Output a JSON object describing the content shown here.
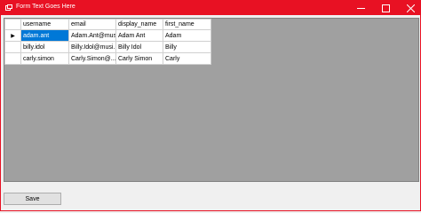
{
  "window": {
    "title": "Form Text Goes Here",
    "accent_color": "#e81123",
    "icons": [
      "app-icon",
      "minimize-icon",
      "maximize-icon",
      "close-icon"
    ]
  },
  "grid": {
    "columns": [
      "username",
      "email",
      "display_name",
      "first_name"
    ],
    "rows": [
      [
        "adam.ant",
        "Adam.Ant@musi...",
        "Adam Ant",
        "Adam"
      ],
      [
        "billy.idol",
        "Billy.Idol@musi...",
        "Billy Idol",
        "Billy"
      ],
      [
        "carly.simon",
        "Carly.Simon@...",
        "Carly Simon",
        "Carly"
      ]
    ],
    "current_row_marker": "▶"
  },
  "footer": {
    "save_label": "Save"
  }
}
